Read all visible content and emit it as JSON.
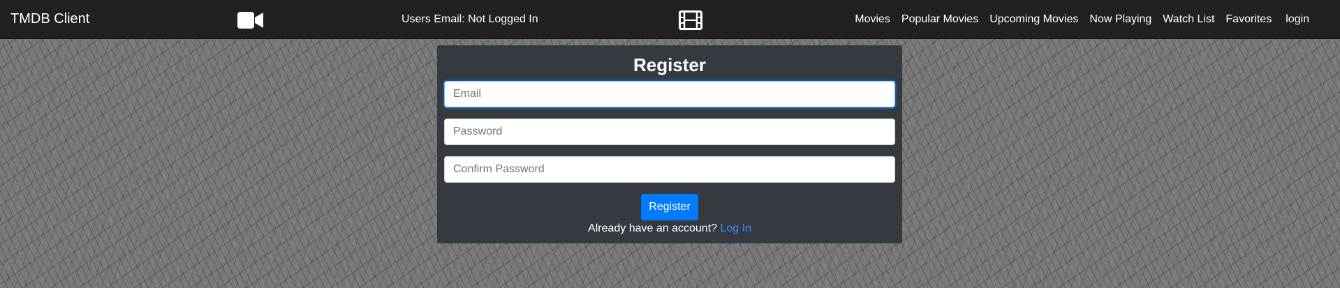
{
  "navbar": {
    "brand": "TMDB Client",
    "user_email": "Users Email: Not Logged In",
    "icons": {
      "left": "video-camera-icon",
      "center": "film-icon"
    },
    "links": [
      {
        "label": "Movies"
      },
      {
        "label": "Popular Movies"
      },
      {
        "label": "Upcoming Movies"
      },
      {
        "label": "Now Playing"
      },
      {
        "label": "Watch List"
      },
      {
        "label": "Favorites"
      },
      {
        "label": "login"
      }
    ]
  },
  "register": {
    "title": "Register",
    "email": {
      "placeholder": "Email",
      "value": ""
    },
    "password": {
      "placeholder": "Password",
      "value": ""
    },
    "confirm_password": {
      "placeholder": "Confirm Password",
      "value": ""
    },
    "submit_label": "Register",
    "account_prompt": "Already have an account?",
    "login_link": "Log In"
  },
  "colors": {
    "navbar_bg": "#212121",
    "card_bg": "#343a40",
    "primary": "#007bff",
    "link": "#3c8dff"
  }
}
